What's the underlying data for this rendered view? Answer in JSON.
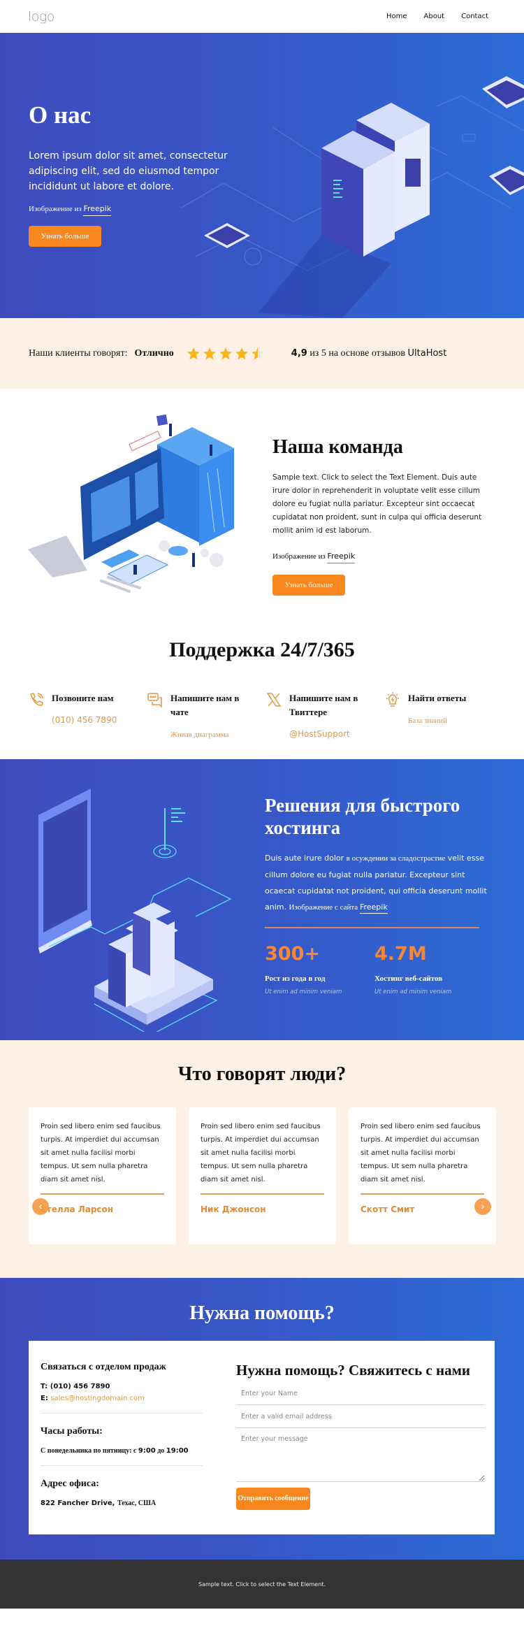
{
  "header": {
    "logo": "logo",
    "nav": [
      "Home",
      "About",
      "Contact"
    ]
  },
  "hero": {
    "title": "О нас",
    "body": "Lorem ipsum dolor sit amet, consectetur adipiscing elit, sed do eiusmod tempor incididunt ut labore et dolore.",
    "credit_prefix": "Изображение из",
    "credit_link": "Freepik",
    "button": "Узнать больше"
  },
  "rating": {
    "label": "Наши клиенты говорят:",
    "verdict": "Отлично",
    "stars": 4.5,
    "score": "4,9",
    "summary_mid": " из 5 на основе отзывов ",
    "brand": "UltaHost",
    "star_color": "#fbb31b"
  },
  "team": {
    "title": "Наша команда",
    "body": "Sample text. Click to select the Text Element. Duis aute irure dolor in reprehenderit in voluptate velit esse cillum dolore eu fugiat nulla pariatur. Excepteur sint occaecat cupidatat non proident, sunt in culpa qui officia deserunt mollit anim id est laborum.",
    "credit_prefix": "Изображение из",
    "credit_link": "Freepik",
    "button": "Узнать больше"
  },
  "support": {
    "title": "Поддержка 24/7/365",
    "items": [
      {
        "icon": "phone-icon",
        "title": "Позвоните нам",
        "link": "(010) 456 7890"
      },
      {
        "icon": "chat-icon",
        "title": "Напишите нам в чате",
        "link": "Живая диаграмма"
      },
      {
        "icon": "x-twitter-icon",
        "title": "Напишите нам в Твиттере",
        "link": "@HostSupport"
      },
      {
        "icon": "lightbulb-icon",
        "title": "Найти ответы",
        "link": "База знаний"
      }
    ]
  },
  "solutions": {
    "title": "Решения для быстрого хостинга",
    "body_a": "Duis aute irure dolor ",
    "body_b": "в осуждении за сладострастие",
    "body_c": " velit esse cillum dolore eu fugiat nulla pariatur. Excepteur sint ocaecat cupidatat not proident, qui officia deserunt mollit anim.  ",
    "credit_prefix": "Изображение с сайта ",
    "credit_link": "Freepik",
    "stats": [
      {
        "value": "300+",
        "caption": "Рост из года в год",
        "sub": "Ut enim ad minim veniam"
      },
      {
        "value": "4.7M",
        "caption": "Хостинг веб-сайтов",
        "sub": "Ut enim ad minim veniam"
      }
    ]
  },
  "testimonials": {
    "title": "Что говорят люди?",
    "cards": [
      {
        "text": "Proin sed libero enim sed faucibus turpis. At imperdiet dui accumsan sit amet nulla facilisi morbi tempus. Ut sem nulla pharetra diam sit amet nisl.",
        "name": "Стелла Ларсон"
      },
      {
        "text": "Proin sed libero enim sed faucibus turpis. At imperdiet dui accumsan sit amet nulla facilisi morbi tempus. Ut sem nulla pharetra diam sit amet nisl.",
        "name": "Ник Джонсон"
      },
      {
        "text": "Proin sed libero enim sed faucibus turpis. At imperdiet dui accumsan sit amet nulla facilisi morbi tempus. Ut sem nulla pharetra diam sit amet nisl.",
        "name": "Скотт Смит"
      }
    ],
    "prev": "‹",
    "next": "›"
  },
  "contact": {
    "title": "Нужна помощь?",
    "sales_title": "Связаться с отделом продаж",
    "phone_label": "T: ",
    "phone": "(010) 456 7890",
    "email_label": "E: ",
    "email": "sales@hostingdomain.com",
    "hours_title": "Часы работы:",
    "hours_prefix": "С понедельника по пятницу: с ",
    "hours_from": "9:00",
    "hours_mid": " до ",
    "hours_to": "19:00",
    "office_title": "Адрес офиса:",
    "address_street": "822 Fancher Drive, ",
    "address_rest": "Техас, США",
    "form_title": "Нужна помощь? Свяжитесь с нами",
    "name_placeholder": "Enter your Name",
    "email_placeholder": "Enter a valid email address",
    "message_placeholder": "Enter your message",
    "submit": "Отправить сообщение"
  },
  "footer": {
    "text": "Sample text. Click to select the Text Element."
  }
}
